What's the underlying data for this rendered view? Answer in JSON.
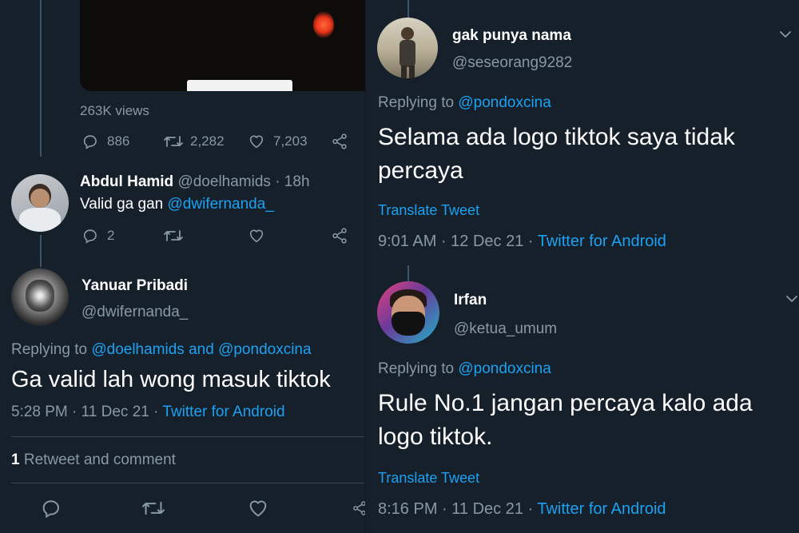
{
  "left": {
    "top_tweet": {
      "views": "263K views",
      "reply_count": "886",
      "retweet_count": "2,282",
      "like_count": "7,203"
    },
    "abdul": {
      "name": "Abdul Hamid",
      "handle": "@doelhamids",
      "time": "· 18h",
      "text_prefix": "Valid ga gan",
      "mention": "@dwifernanda_",
      "reply_count": "2"
    },
    "yanuar": {
      "name": "Yanuar Pribadi",
      "handle": "@dwifernanda_",
      "replying_to_label": "Replying to",
      "replying_user1": "@doelhamids",
      "replying_and": "and",
      "replying_user2": "@pondoxcina",
      "text": "Ga valid lah wong masuk tiktok",
      "time": "5:28 PM · 11 Dec 21 ·",
      "source": "Twitter for Android",
      "retweet_count": "1",
      "retweet_label": "Retweet and comment"
    }
  },
  "right": {
    "gak": {
      "name": "gak punya nama",
      "handle": "@seseorang9282",
      "replying_to_label": "Replying to",
      "replying_user": "@pondoxcina",
      "text": "Selama ada logo tiktok saya tidak percaya",
      "translate": "Translate Tweet",
      "time": "9:01 AM · 12 Dec 21 ·",
      "source": "Twitter for Android"
    },
    "irfan": {
      "name": "Irfan",
      "handle": "@ketua_umum",
      "replying_to_label": "Replying to",
      "replying_user": "@pondoxcina",
      "text": "Rule No.1 jangan percaya kalo ada logo tiktok.",
      "translate": "Translate Tweet",
      "time": "8:16 PM · 11 Dec 21 ·",
      "source": "Twitter for Android"
    }
  },
  "colors": {
    "background": "#15202b",
    "link": "#1da1f2",
    "secondary_text": "#8899a6",
    "divider": "#38444d"
  }
}
